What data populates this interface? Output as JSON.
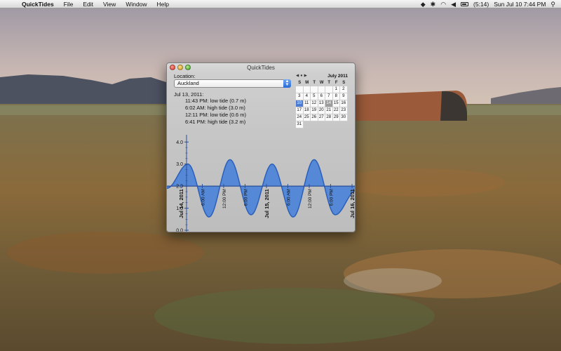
{
  "menubar": {
    "app_name": "QuickTides",
    "menus": [
      "File",
      "Edit",
      "View",
      "Window",
      "Help"
    ],
    "battery_text": "(5:14)",
    "clock": "Sun Jul 10  7:44 PM"
  },
  "window": {
    "title": "QuickTides",
    "location_label": "Location:",
    "location_value": "Auckland",
    "tide_date": "Jul 13, 2011:",
    "tides": [
      "11:43 PM: low tide (0.7 m)",
      "6:02 AM: high tide (3.0 m)",
      "12:11 PM: low tide (0.6 m)",
      "6:41 PM: high tide (3.2 m)"
    ]
  },
  "calendar": {
    "month": "July 2011",
    "days_of_week": [
      "S",
      "M",
      "T",
      "W",
      "T",
      "F",
      "S"
    ],
    "leading_blanks": 5,
    "days": 31,
    "today": 10,
    "selected": 14,
    "colors": {
      "today": "#4a7cd6",
      "selected": "#9c9c9c"
    }
  },
  "chart_data": {
    "type": "area",
    "title": "",
    "ylabel": "",
    "xlabel": "",
    "ylim": [
      0,
      4.2
    ],
    "yticks": [
      "0.0",
      "1.0",
      "2.0",
      "3.0",
      "4.0"
    ],
    "x_tick_labels": [
      "Jul 14, 2011",
      "6:00 AM",
      "12:00 PM",
      "6:00 PM",
      "Jul 15, 2011",
      "6:00 AM",
      "12:00 PM",
      "6:00 PM",
      "Jul 16, 2011"
    ],
    "series": [
      {
        "values": [
          1.9,
          3.0,
          0.6,
          3.2,
          0.7,
          3.0,
          0.6,
          3.2,
          0.7,
          1.8
        ]
      }
    ],
    "fill_color": "#4f86d8",
    "line_color": "#2c5fb8"
  }
}
